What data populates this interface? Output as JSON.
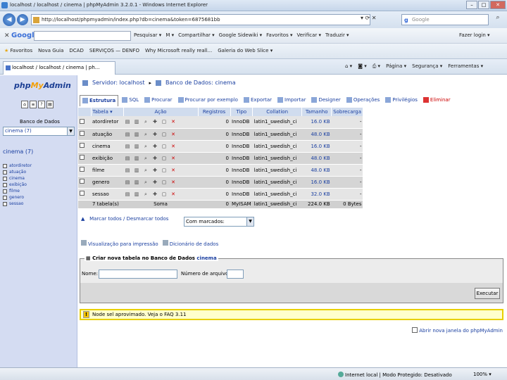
{
  "window": {
    "title": "localhost / localhost / cinema | phpMyAdmin 3.2.0.1 - Windows Internet Explorer"
  },
  "address_bar": {
    "url": "http://localhost/phpmyadmin/index.php?db=cinema&token=6875681bb",
    "search_placeholder": "Google"
  },
  "google_toolbar": {
    "logo": "Google",
    "items": [
      "Pesquisar ▾",
      "M ▾",
      "Compartilhar ▾",
      "Google Sidewiki ▾",
      "Favoritos ▾",
      "Verificar ▾",
      "Traduzir ▾"
    ],
    "right": "Fazer login ▾"
  },
  "favorites_bar": {
    "items": [
      "Favoritos",
      "Nova Guia",
      "DCAD",
      "SERVIÇOS — DENFO",
      "Why Microsoft really reall...",
      "Galeria do Web Slice ▾"
    ]
  },
  "tab": {
    "label": "localhost / localhost / cinema | ph..."
  },
  "command_bar": {
    "items": [
      "Página ▾",
      "Segurança ▾",
      "Ferramentas ▾"
    ]
  },
  "sidebar": {
    "logo_php": "php",
    "logo_my": "My",
    "logo_admin": "Admin",
    "db_label": "Banco de Dados",
    "db_selected": "cinema (7)",
    "db_name": "cinema (7)",
    "tables": [
      "atordiretor",
      "atuação",
      "cinema",
      "exibição",
      "filme",
      "genero",
      "sessao"
    ]
  },
  "breadcrumb": {
    "server": "Servidor: localhost",
    "database": "Banco de Dados: cinema"
  },
  "tabs": [
    {
      "label": "Estrutura",
      "active": true
    },
    {
      "label": "SQL"
    },
    {
      "label": "Procurar"
    },
    {
      "label": "Procurar por exemplo"
    },
    {
      "label": "Exportar"
    },
    {
      "label": "Importar"
    },
    {
      "label": "Designer"
    },
    {
      "label": "Operações"
    },
    {
      "label": "Privilégios"
    },
    {
      "label": "Eliminar",
      "danger": true
    }
  ],
  "table": {
    "headers": {
      "tabela": "Tabela ▾",
      "acao": "Ação",
      "registros": "Registros",
      "tipo": "Tipo",
      "collation": "Collation",
      "tamanho": "Tamanho",
      "sobrecarga": "Sobrecarga"
    },
    "rows": [
      {
        "name": "atordiretor",
        "records": "0",
        "type": "InnoDB",
        "collation": "latin1_swedish_ci",
        "size": "16.0 KB",
        "overhead": "-"
      },
      {
        "name": "atuação",
        "records": "0",
        "type": "InnoDB",
        "collation": "latin1_swedish_ci",
        "size": "48.0 KB",
        "overhead": "-"
      },
      {
        "name": "cinema",
        "records": "0",
        "type": "InnoDB",
        "collation": "latin1_swedish_ci",
        "size": "16.0 KB",
        "overhead": "-"
      },
      {
        "name": "exibição",
        "records": "0",
        "type": "InnoDB",
        "collation": "latin1_swedish_ci",
        "size": "48.0 KB",
        "overhead": "-"
      },
      {
        "name": "filme",
        "records": "0",
        "type": "InnoDB",
        "collation": "latin1_swedish_ci",
        "size": "48.0 KB",
        "overhead": "-"
      },
      {
        "name": "genero",
        "records": "0",
        "type": "InnoDB",
        "collation": "latin1_swedish_ci",
        "size": "16.0 KB",
        "overhead": "-"
      },
      {
        "name": "sessao",
        "records": "0",
        "type": "InnoDB",
        "collation": "latin1_swedish_ci",
        "size": "32.0 KB",
        "overhead": "-"
      }
    ],
    "summary": {
      "name": "7 tabela(s)",
      "label": "Soma",
      "records": "0",
      "type": "MyISAM",
      "collation": "latin1_swedish_ci",
      "size": "224.0 KB",
      "overhead": "0 Bytes"
    }
  },
  "bulk": {
    "check_all": "Marcar todos / Desmarcar todos",
    "with_selected": "Com marcados:"
  },
  "links": {
    "print": "Visualização para impressão",
    "dictionary": "Dicionário de dados"
  },
  "create_table": {
    "legend_prefix": "Criar nova tabela no Banco de Dados",
    "legend_db": "cinema",
    "name_label": "Nome:",
    "fields_label": "Número de arquivos:",
    "execute": "Executar"
  },
  "notice": {
    "text": "Node sel aprovimado. Veja o FAQ 3.11"
  },
  "new_window": "Abrir nova janela do phpMyAdmin",
  "statusbar": {
    "zone": "Internet local | Modo Protegido: Desativado",
    "zoom": "100%"
  }
}
